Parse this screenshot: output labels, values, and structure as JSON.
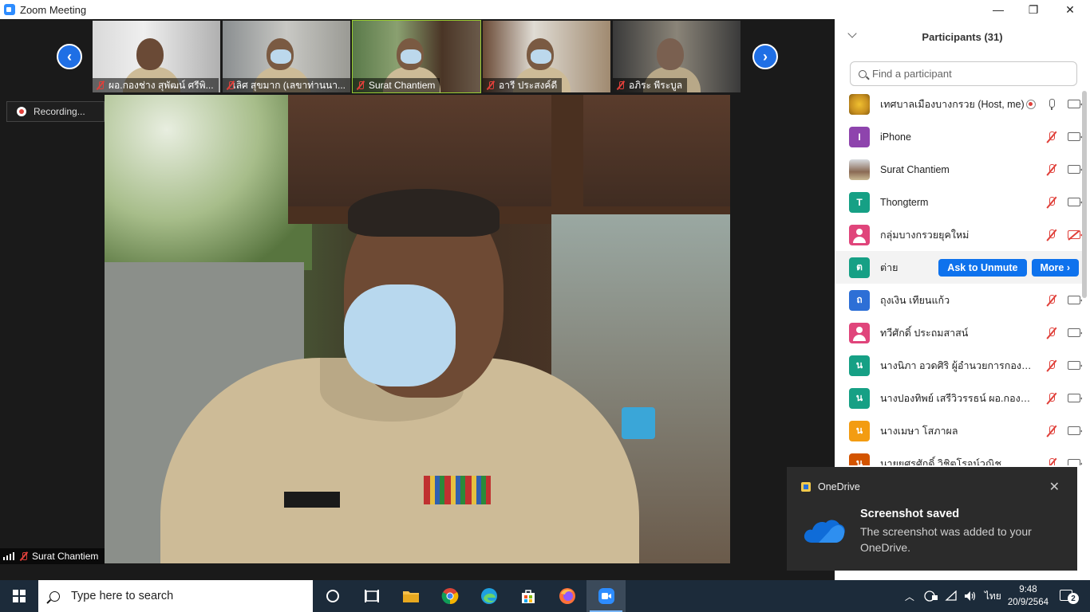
{
  "window": {
    "title": "Zoom Meeting",
    "minimize": "—",
    "maximize": "❐",
    "close": "✕"
  },
  "thumbnails": [
    {
      "name": "ผอ.กองช่าง สุพัฒน์ ศรีพิ..."
    },
    {
      "name": "เลิศ สุขมาก (เลขาท่านนา..."
    },
    {
      "name": "Surat Chantiem"
    },
    {
      "name": "อารี ประสงค์ดี"
    },
    {
      "name": "อภิระ พีระบูล"
    }
  ],
  "nav": {
    "prev": "‹",
    "next": "›"
  },
  "recording": {
    "label": "Recording..."
  },
  "active_speaker": {
    "name": "Surat Chantiem"
  },
  "participants": {
    "title": "Participants (31)",
    "search_placeholder": "Find a participant",
    "ask_to_unmute": "Ask to Unmute",
    "more": "More ›",
    "items": [
      {
        "initial": "",
        "name": "เทศบาลเมืองบางกรวย (Host, me)",
        "color": ""
      },
      {
        "initial": "I",
        "name": "iPhone",
        "color": "#8e44ad"
      },
      {
        "initial": "",
        "name": "Surat Chantiem",
        "color": ""
      },
      {
        "initial": "T",
        "name": "Thongterm",
        "color": "#16a085"
      },
      {
        "initial": "",
        "name": "กลุ่มบางกรวยยุคใหม่",
        "color": ""
      },
      {
        "initial": "ต",
        "name": "ต่าย",
        "color": "#16a085"
      },
      {
        "initial": "ถ",
        "name": "ถุงเงิน เทียนแก้ว",
        "color": "#2d6fd6"
      },
      {
        "initial": "",
        "name": "ทวีศักดิ์ ประถมสาสน์",
        "color": ""
      },
      {
        "initial": "น",
        "name": "นางนิภา อวดศิริ  ผู้อำนวยการกองคลัง",
        "color": "#16a085"
      },
      {
        "initial": "น",
        "name": "นางปองทิพย์ เสรีวิวรรธน์ ผอ.กองสวัส...",
        "color": "#16a085"
      },
      {
        "initial": "น",
        "name": "นางเมษา  โสภาผล",
        "color": "#f39c12"
      },
      {
        "initial": "น",
        "name": "นายยศรศักดิ์ วิชิตโรจน์วณิช",
        "color": "#d35400"
      }
    ]
  },
  "toast": {
    "app": "OneDrive",
    "title": "Screenshot saved",
    "body": "The screenshot was added to your OneDrive.",
    "close": "✕"
  },
  "taskbar": {
    "search_placeholder": "Type here to search",
    "lang": "ไทย",
    "time": "9:48",
    "date": "20/9/2564",
    "notifications": "2"
  },
  "colors": {
    "accent": "#0e72ed",
    "mute": "#e0403a",
    "taskbar": "#1c2b3a"
  }
}
